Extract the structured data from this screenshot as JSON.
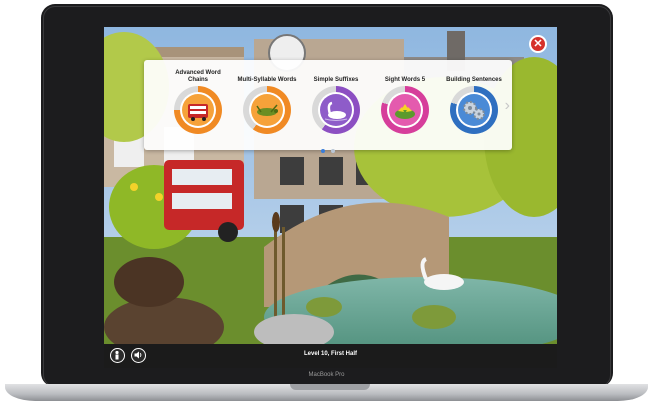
{
  "device": {
    "model_label": "MacBook Pro"
  },
  "topics": [
    {
      "label": "Advanced Word Chains",
      "icon": "double-decker-bus-icon",
      "ring_color": "#f08a24",
      "fill_color": "#f6a23a",
      "progress": 0.75
    },
    {
      "label": "Multi-Syllable Words",
      "icon": "grasshopper-icon",
      "ring_color": "#f08a24",
      "fill_color": "#f6a23a",
      "progress": 0.6
    },
    {
      "label": "Simple Suffixes",
      "icon": "swan-icon",
      "ring_color": "#8c4fc2",
      "fill_color": "#8e5cc9",
      "progress": 0.6
    },
    {
      "label": "Sight Words 5",
      "icon": "lily-frog-icon",
      "ring_color": "#d63e9b",
      "fill_color": "#e45aae",
      "progress": 0.8
    },
    {
      "label": "Building Sentences",
      "icon": "gears-icon",
      "ring_color": "#2f6fc0",
      "fill_color": "#4a8ad6",
      "progress": 0.8
    }
  ],
  "carousel": {
    "page_count": 2,
    "active_page": 1
  },
  "bottom_bar": {
    "level_text": "Level 10, First Half"
  },
  "colors": {
    "accent_close": "#d6322b",
    "bar": "#1b1b1b"
  }
}
